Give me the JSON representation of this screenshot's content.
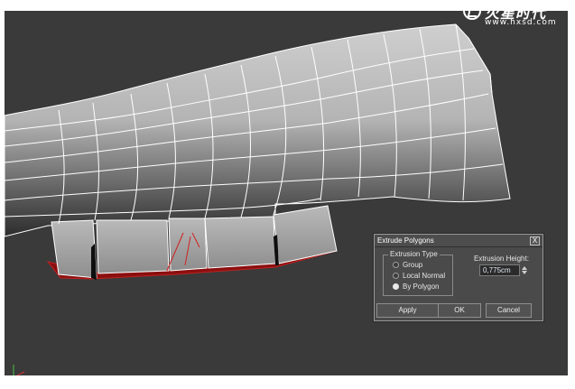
{
  "watermark": {
    "title": "火星时代",
    "url": "www.hxsd.com"
  },
  "viewport": {
    "background": "#3a3a3a",
    "mesh_color": "#a8a8a8",
    "wire_color": "#ffffff",
    "extrude_color": "#8b0f0f"
  },
  "dialog": {
    "title": "Extrude Polygons",
    "close_label": "X",
    "extrusion_type": {
      "legend": "Extrusion Type",
      "options": [
        {
          "label": "Group",
          "checked": false
        },
        {
          "label": "Local Normal",
          "checked": false
        },
        {
          "label": "By Polygon",
          "checked": true
        }
      ]
    },
    "extrusion_height": {
      "label": "Extrusion Height:",
      "value": "0,775cm"
    },
    "buttons": {
      "apply": "Apply",
      "ok": "OK",
      "cancel": "Cancel"
    }
  }
}
